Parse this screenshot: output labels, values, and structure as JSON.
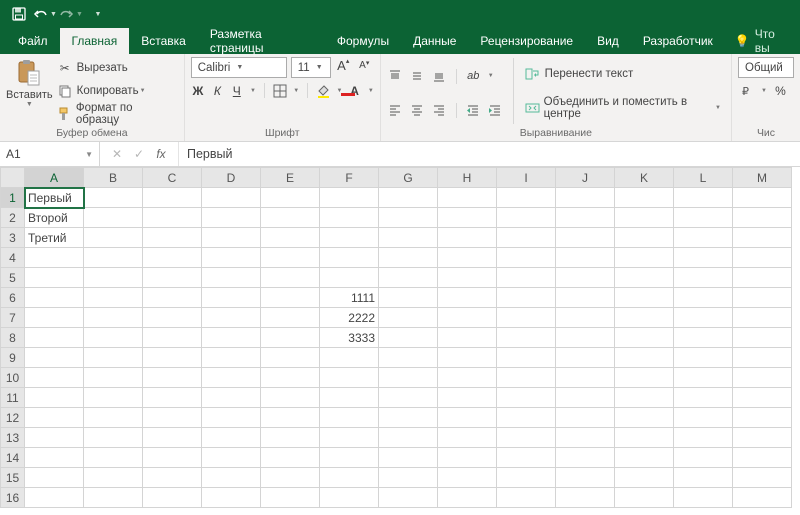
{
  "qat": {
    "save": "save",
    "undo": "undo",
    "redo": "redo"
  },
  "tabs": {
    "file": "Файл",
    "home": "Главная",
    "insert": "Вставка",
    "layout": "Разметка страницы",
    "formulas": "Формулы",
    "data": "Данные",
    "review": "Рецензирование",
    "view": "Вид",
    "developer": "Разработчик",
    "tell_me": "Что вы"
  },
  "ribbon": {
    "clipboard": {
      "paste": "Вставить",
      "cut": "Вырезать",
      "copy": "Копировать",
      "format_painter": "Формат по образцу",
      "group_label": "Буфер обмена"
    },
    "font": {
      "name": "Calibri",
      "size": "11",
      "group_label": "Шрифт"
    },
    "alignment": {
      "wrap_text": "Перенести текст",
      "merge_center": "Объединить и поместить в центре",
      "group_label": "Выравнивание"
    },
    "number": {
      "format": "Общий",
      "group_label": "Чис"
    }
  },
  "formula_bar": {
    "cell_ref": "A1",
    "value": "Первый"
  },
  "grid": {
    "cols": [
      "A",
      "B",
      "C",
      "D",
      "E",
      "F",
      "G",
      "H",
      "I",
      "J",
      "K",
      "L",
      "M"
    ],
    "rows": 16,
    "selected": {
      "r": 1,
      "c": "A"
    },
    "cells": {
      "A1": "Первый",
      "A2": "Второй",
      "A3": "Третий",
      "F6": "1111",
      "F7": "2222",
      "F8": "3333"
    }
  }
}
